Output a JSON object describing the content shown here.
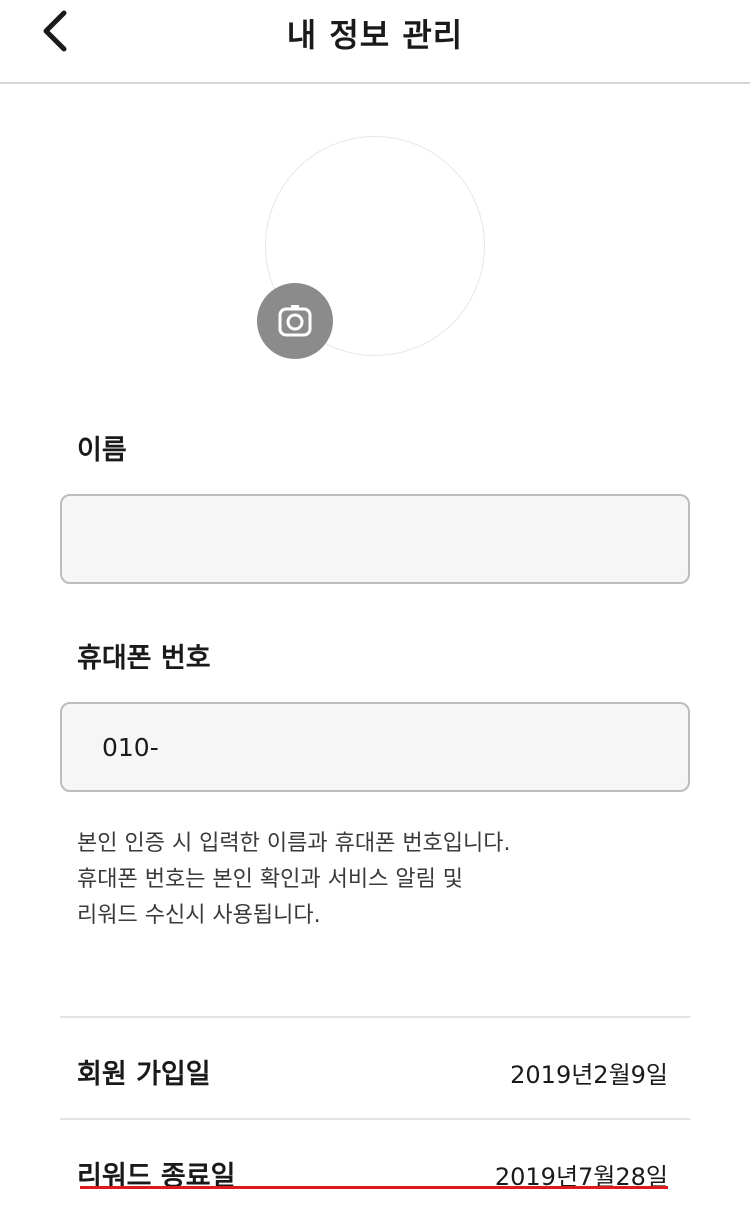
{
  "header": {
    "title": "내 정보 관리",
    "back_icon": "chevron-left-icon"
  },
  "profile": {
    "camera_icon": "camera-icon"
  },
  "form": {
    "name_label": "이름",
    "name_value": "",
    "phone_label": "휴대폰 번호",
    "phone_value": "010-"
  },
  "notice": {
    "lines": [
      "본인 인증 시 입력한 이름과 휴대폰 번호입니다.",
      "휴대폰 번호는 본인 확인과 서비스 알림 및",
      "리워드 수신시 사용됩니다."
    ]
  },
  "info_rows": [
    {
      "label": "회원 가입일",
      "value": "2019년2월9일"
    },
    {
      "label": "리워드 종료일",
      "value": "2019년7월28일"
    }
  ],
  "colors": {
    "accent_underline": "#e3171c",
    "camera_button": "#8b8b8b"
  }
}
